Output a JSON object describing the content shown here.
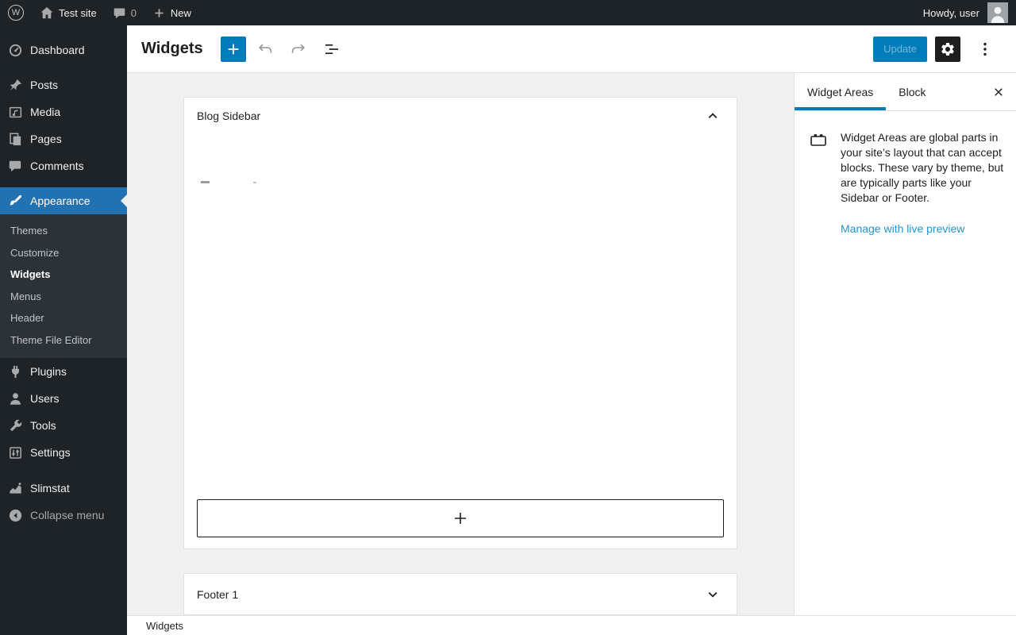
{
  "colors": {
    "admin_bar_bg": "#1d2327",
    "menu_bg": "#1d2327",
    "submenu_bg": "#2c3338",
    "admin_accent": "#2271b1",
    "editor_accent": "#007cba",
    "canvas_bg": "#f0f0f1",
    "border": "#e0e0e0",
    "link": "#2196d3"
  },
  "icons": {
    "wp_logo_glyph": "W"
  },
  "admin_bar": {
    "site_name": "Test site",
    "comment_count": "0",
    "new_label": "New",
    "greeting": "Howdy, user"
  },
  "sidebar": {
    "items": [
      {
        "label": "Dashboard"
      },
      {
        "label": "Posts"
      },
      {
        "label": "Media"
      },
      {
        "label": "Pages"
      },
      {
        "label": "Comments"
      },
      {
        "label": "Appearance"
      },
      {
        "label": "Plugins"
      },
      {
        "label": "Users"
      },
      {
        "label": "Tools"
      },
      {
        "label": "Settings"
      },
      {
        "label": "Slimstat"
      }
    ],
    "appearance_submenu": [
      {
        "label": "Themes"
      },
      {
        "label": "Customize"
      },
      {
        "label": "Widgets"
      },
      {
        "label": "Menus"
      },
      {
        "label": "Header"
      },
      {
        "label": "Theme File Editor"
      }
    ],
    "collapse_label": "Collapse menu"
  },
  "header": {
    "title": "Widgets",
    "update_label": "Update"
  },
  "content": {
    "panels": [
      {
        "title": "Blog Sidebar"
      },
      {
        "title": "Footer 1"
      }
    ]
  },
  "inspector": {
    "tabs": [
      {
        "label": "Widget Areas"
      },
      {
        "label": "Block"
      }
    ],
    "description": "Widget Areas are global parts in your site’s layout that can accept blocks. These vary by theme, but are typically parts like your Sidebar or Footer.",
    "link_label": "Manage with live preview"
  },
  "footer": {
    "breadcrumb": "Widgets"
  }
}
